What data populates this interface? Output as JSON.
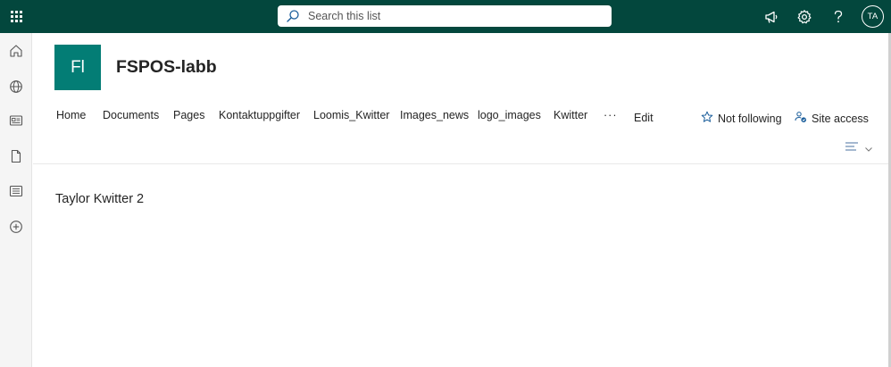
{
  "suite_bar": {
    "search_placeholder": "Search this list",
    "avatar_initials": "TA",
    "icons": [
      "app-launcher-icon",
      "search-icon",
      "megaphone-icon",
      "gear-icon",
      "help-icon"
    ]
  },
  "app_bar": {
    "items": [
      "home-icon",
      "globe-icon",
      "news-icon",
      "file-icon",
      "list-icon",
      "create-icon"
    ]
  },
  "site": {
    "logo_initials": "Fl",
    "title": "FSPOS-labb",
    "colors": {
      "suite_bar": "#03473d",
      "logo": "#037d75"
    }
  },
  "nav": {
    "items": [
      {
        "label": "Home"
      },
      {
        "label": "Documents"
      },
      {
        "label": "Pages"
      },
      {
        "label": "Kontaktuppgifter"
      },
      {
        "label": "Loomis_Kwitter"
      },
      {
        "label": "Images_news"
      },
      {
        "label": "logo_images"
      },
      {
        "label": "Kwitter"
      }
    ],
    "more_label": "···",
    "edit_label": "Edit"
  },
  "actions": {
    "follow_label": "Not following",
    "site_access_label": "Site access"
  },
  "main": {
    "list_title": "Taylor Kwitter 2"
  }
}
